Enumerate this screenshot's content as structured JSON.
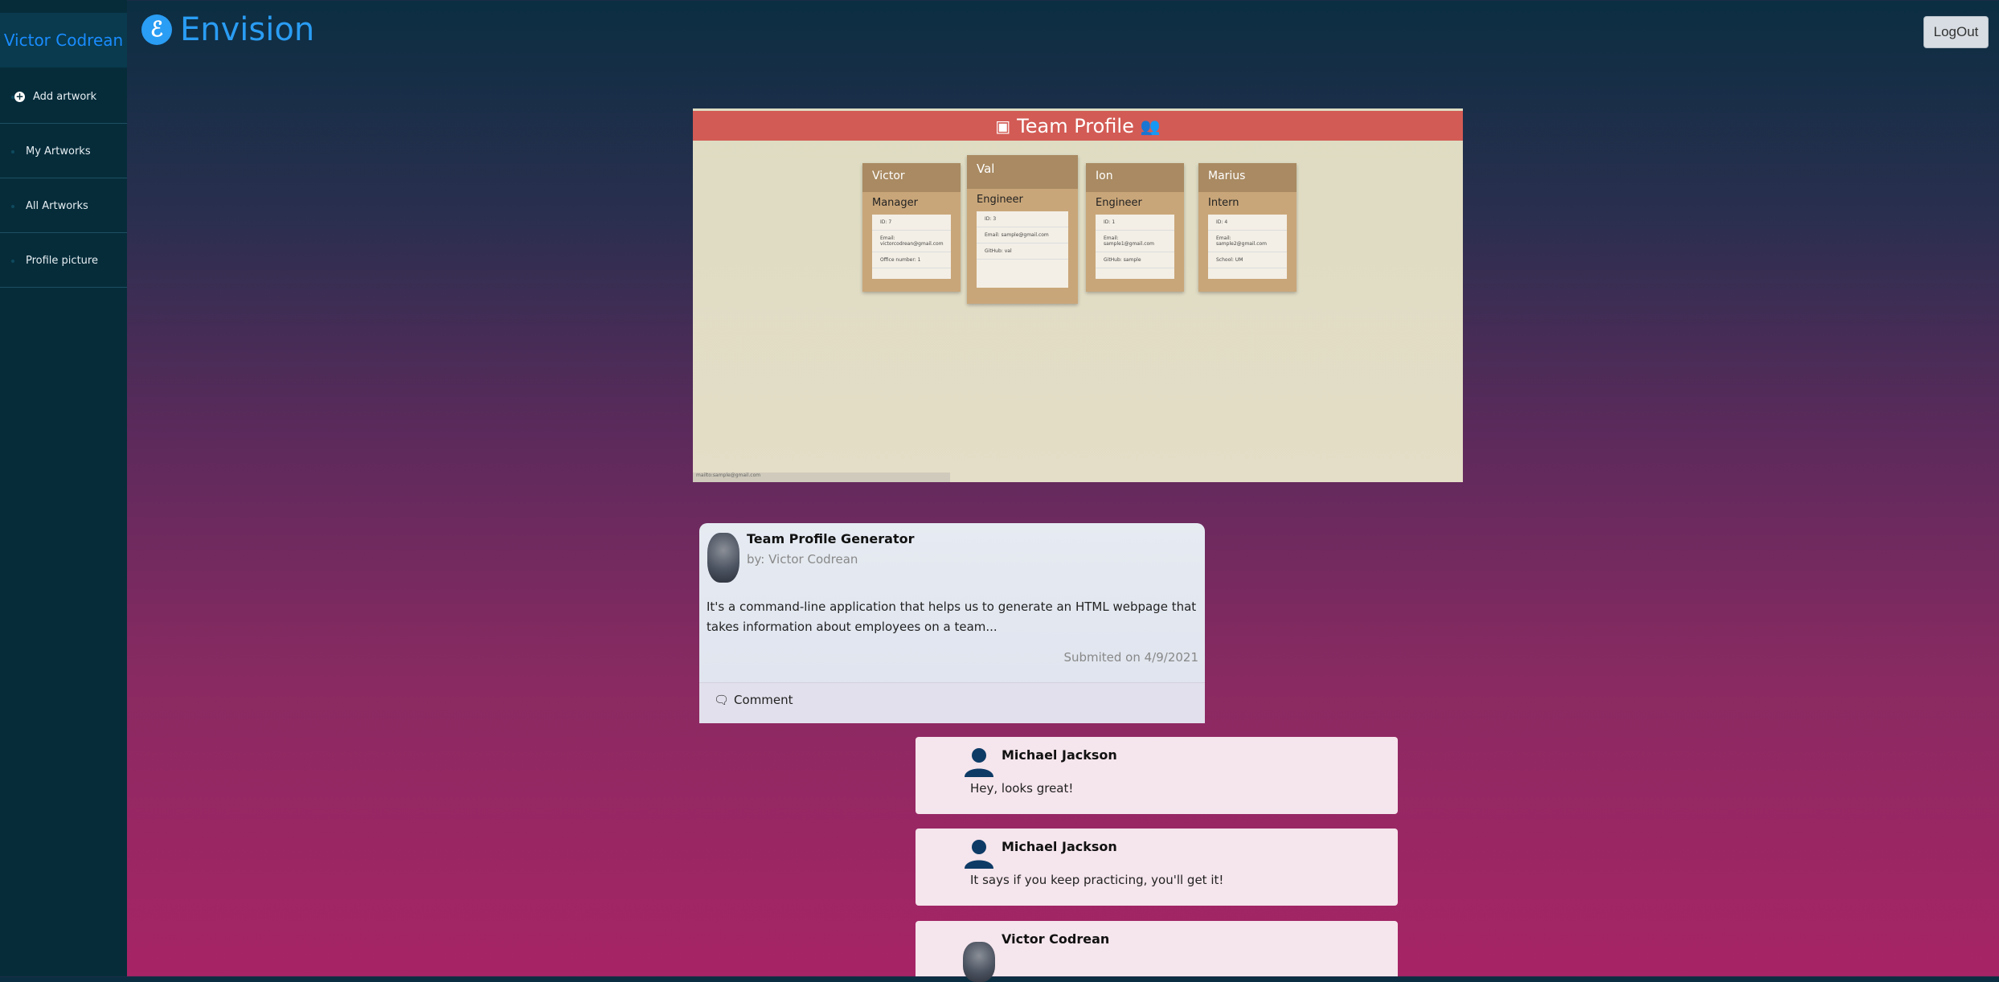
{
  "app": {
    "name": "Envision",
    "logo_glyph": "ℰ"
  },
  "header": {
    "logout_label": "LogOut"
  },
  "sidebar": {
    "user_name": "Victor Codrean",
    "items": [
      {
        "label": "Add artwork",
        "icon": "plus-circle-icon"
      },
      {
        "label": "My Artworks"
      },
      {
        "label": "All Artworks"
      },
      {
        "label": "Profile picture"
      }
    ]
  },
  "preview": {
    "banner_title": "Team Profile",
    "members": [
      {
        "name": "Victor",
        "role": "Manager",
        "rows": [
          "ID: 7",
          "Email: victorcodrean@gmail.com",
          "Office number: 1"
        ]
      },
      {
        "name": "Val",
        "role": "Engineer",
        "rows": [
          "ID: 3",
          "Email: sample@gmail.com",
          "GitHub: val"
        ]
      },
      {
        "name": "Ion",
        "role": "Engineer",
        "rows": [
          "ID: 1",
          "Email: sample1@gmail.com",
          "GitHub: sample"
        ]
      },
      {
        "name": "Marius",
        "role": "Intern",
        "rows": [
          "ID: 4",
          "Email: sample2@gmail.com",
          "School: UM"
        ]
      }
    ],
    "status_text": "mailto:sample@gmail.com"
  },
  "post": {
    "title": "Team Profile Generator",
    "author": "by: Victor Codrean",
    "description": "It's a command-line application that helps us to generate an HTML webpage that takes information about employees on a team...",
    "submitted": "Submited on 4/9/2021",
    "comment_label": "Comment"
  },
  "comments": [
    {
      "name": "Michael Jackson",
      "text": "Hey, looks great!"
    },
    {
      "name": "Michael Jackson",
      "text": "It says if you keep practicing, you'll get it!"
    },
    {
      "name": "Victor Codrean",
      "text": ""
    }
  ],
  "colors": {
    "accent": "#2a9df4",
    "sidebar_bg": "#062c3a",
    "banner_red": "#d35b55",
    "card_tan": "#c9a679"
  }
}
